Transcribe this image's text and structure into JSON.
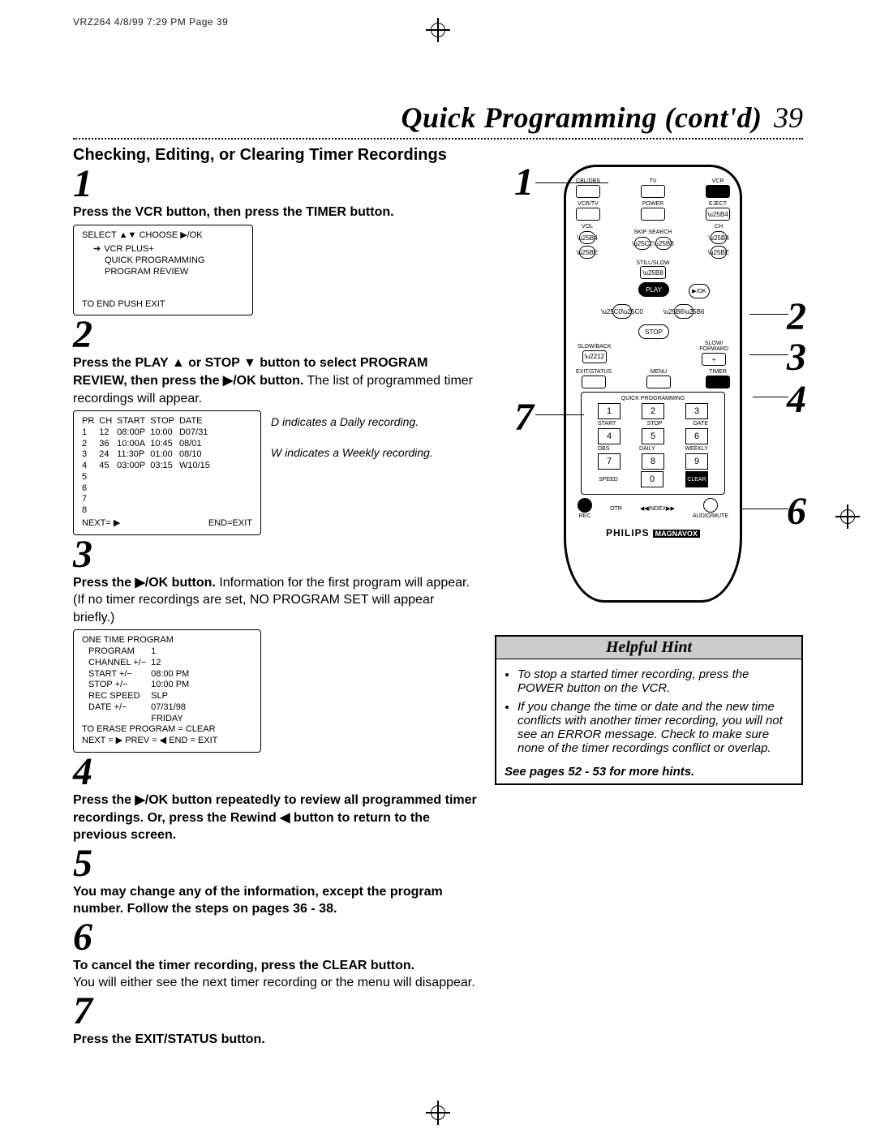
{
  "meta": {
    "header": "VRZ264  4/8/99 7:29 PM  Page 39"
  },
  "title": {
    "text": "Quick Programming (cont'd)",
    "page": "39"
  },
  "subheading": "Checking, Editing, or Clearing Timer Recordings",
  "steps": {
    "s1": {
      "num": "1",
      "text": "Press the VCR button, then press the TIMER button.",
      "screen": {
        "line1": "SELECT ▲▼        CHOOSE ▶/OK",
        "opt1": "VCR PLUS+",
        "opt2": "QUICK PROGRAMMING",
        "opt3": "PROGRAM REVIEW",
        "foot": "TO END PUSH EXIT"
      }
    },
    "s2": {
      "num": "2",
      "bold": "Press the PLAY ▲ or STOP ▼ button to select PROGRAM REVIEW, then press the ▶/OK button.",
      "rest": " The list of programmed timer recordings will appear.",
      "table": {
        "head": [
          "PR",
          "CH",
          "START",
          "STOP",
          "DATE"
        ],
        "rows": [
          [
            "1",
            "12",
            "08:00P",
            "10:00",
            "D07/31"
          ],
          [
            "2",
            "36",
            "10:00A",
            "10:45",
            "08/01"
          ],
          [
            "3",
            "24",
            "11:30P",
            "01:00",
            "08/10"
          ],
          [
            "4",
            "45",
            "03:00P",
            "03:15",
            "W10/15"
          ],
          [
            "5",
            "",
            "",
            "",
            ""
          ],
          [
            "6",
            "",
            "",
            "",
            ""
          ],
          [
            "7",
            "",
            "",
            "",
            ""
          ],
          [
            "8",
            "",
            "",
            "",
            ""
          ]
        ],
        "foot_l": "NEXT= ▶",
        "foot_r": "END=EXIT"
      },
      "annot1": "D indicates a Daily recording.",
      "annot2": "W indicates a Weekly recording."
    },
    "s3": {
      "num": "3",
      "bold": "Press the ▶/OK button.",
      "rest": " Information for the first program will appear. (If no timer recordings are set, NO PROGRAM SET will appear briefly.)",
      "screen": {
        "title": "ONE TIME PROGRAM",
        "rows": [
          [
            "PROGRAM",
            "1"
          ],
          [
            "CHANNEL +/−",
            "12"
          ],
          [
            "START +/−",
            "08:00  PM"
          ],
          [
            "STOP +/−",
            "10:00  PM"
          ],
          [
            "REC SPEED",
            "SLP"
          ],
          [
            "DATE +/−",
            "07/31/98"
          ]
        ],
        "day": "FRIDAY",
        "foot1": "TO ERASE PROGRAM = CLEAR",
        "foot2": "NEXT = ▶  PREV = ◀  END = EXIT"
      }
    },
    "s4": {
      "num": "4",
      "text": "Press the ▶/OK button repeatedly to review all programmed timer recordings. Or, press the Rewind ◀ button to return to the previous screen."
    },
    "s5": {
      "num": "5",
      "text": "You may change any of the information, except the program number.  Follow the steps on pages 36 - 38."
    },
    "s6": {
      "num": "6",
      "bold": "To cancel the timer recording, press the CLEAR button.",
      "rest": "You will either see the next timer recording or the menu will disappear."
    },
    "s7": {
      "num": "7",
      "text": "Press the EXIT/STATUS button."
    }
  },
  "callouts": {
    "c1": "1",
    "c2": "2",
    "c3": "3",
    "c4": "4",
    "c6": "6",
    "c7": "7"
  },
  "remote": {
    "row1": [
      "CBL/DBS",
      "TV",
      "VCR"
    ],
    "row2": [
      "VCR/TV",
      "POWER",
      "EJECT"
    ],
    "row3l": "VOL",
    "row3m": "SKIP SEARCH",
    "row3r": "CH",
    "still": "STILL/SLOW",
    "play": "PLAY",
    "stop": "STOP",
    "ok": "▶/OK",
    "slowback": "SLOW/BACK",
    "slowfwd": "SLOW/\nFORWARD",
    "row5": [
      "EXIT/STATUS",
      "MENU",
      "TIMER"
    ],
    "qp_title": "QUICK PROGRAMMING",
    "kp": [
      "1",
      "2",
      "3",
      "4",
      "5",
      "6",
      "7",
      "8",
      "9",
      "0"
    ],
    "kplbl1": [
      "START",
      "STOP",
      "DATE"
    ],
    "kplbl2": [
      "DBS",
      "DAILY",
      "WEEKLY"
    ],
    "speed": "SPEED",
    "clear": "CLEAR",
    "bottom": [
      "REC",
      "OTR",
      "◀◀INDEX▶▶",
      "AUDIO/MUTE"
    ],
    "brand": "PHILIPS",
    "brand2": "MAGNAVOX"
  },
  "hint": {
    "title": "Helpful Hint",
    "items": [
      "To stop a started timer recording, press the POWER button on the VCR.",
      "If you change the time or date and the new time conflicts with another timer recording, you will not see an ERROR message. Check to make sure none of the timer recordings conflict or overlap."
    ],
    "foot": "See pages 52 - 53 for more hints."
  }
}
